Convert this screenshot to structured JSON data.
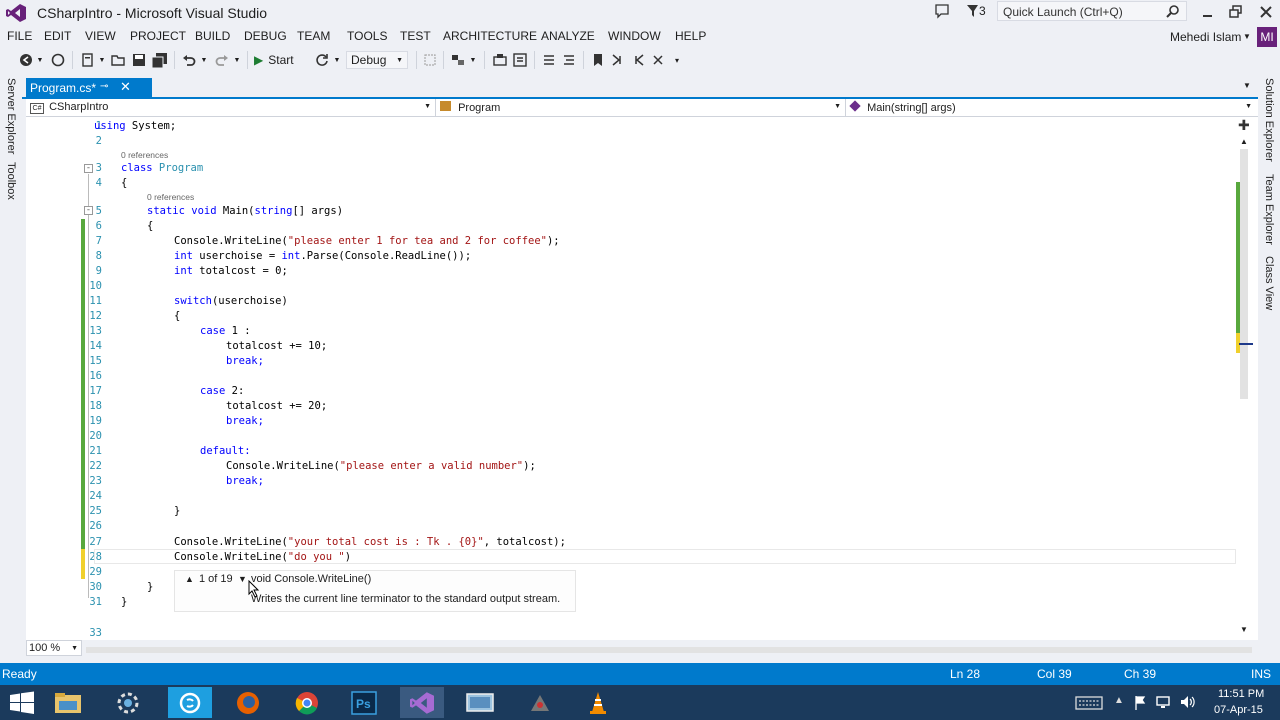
{
  "window": {
    "title": "CSharpIntro - Microsoft Visual Studio",
    "notification_count": "3",
    "quick_launch_placeholder": "Quick Launch (Ctrl+Q)",
    "user_name": "Mehedi Islam",
    "user_initials": "MI"
  },
  "menu": [
    "FILE",
    "EDIT",
    "VIEW",
    "PROJECT",
    "BUILD",
    "DEBUG",
    "TEAM",
    "TOOLS",
    "TEST",
    "ARCHITECTURE",
    "ANALYZE",
    "WINDOW",
    "HELP"
  ],
  "toolbar": {
    "start_label": "Start",
    "config_value": "Debug"
  },
  "left_panels": [
    "Server Explorer",
    "Toolbox"
  ],
  "right_panels": [
    "Solution Explorer",
    "Team Explorer",
    "Class View"
  ],
  "document_tab": {
    "label": "Program.cs*"
  },
  "nav": {
    "project": "CSharpIntro",
    "class": "Program",
    "member": "Main(string[] args)"
  },
  "code": {
    "references_label": "0 references",
    "line_numbers": [
      "1",
      "2",
      "3",
      "4",
      "5",
      "6",
      "7",
      "8",
      "9",
      "10",
      "11",
      "12",
      "13",
      "14",
      "15",
      "16",
      "17",
      "18",
      "19",
      "20",
      "21",
      "22",
      "23",
      "24",
      "25",
      "26",
      "27",
      "28",
      "29",
      "30",
      "31",
      "33"
    ],
    "lines": {
      "l1a": "using",
      "l1b": " System;",
      "l3a": "class",
      "l3b": " Program",
      "l4": "{",
      "l5a": "static",
      "l5b": " ",
      "l5c": "void",
      "l5d": " Main(",
      "l5e": "string",
      "l5f": "[] args)",
      "l6": "{",
      "l7a": "Console.WriteLine(",
      "l7b": "\"please enter 1 for tea and 2 for coffee\"",
      "l7c": ");",
      "l8a": "int",
      "l8b": " userchoise = ",
      "l8c": "int",
      "l8d": ".Parse(Console.ReadLine());",
      "l9a": "int",
      "l9b": " totalcost = 0;",
      "l11a": "switch",
      "l11b": "(userchoise)",
      "l12": "{",
      "l13a": "case",
      "l13b": " 1 :",
      "l14": "totalcost += 10;",
      "l15": "break;",
      "l17a": "case",
      "l17b": " 2:",
      "l18": "totalcost += 20;",
      "l19": "break;",
      "l21": "default:",
      "l22a": "Console.WriteLine(",
      "l22b": "\"please enter a valid number\"",
      "l22c": ");",
      "l23": "break;",
      "l25": "}",
      "l27a": "Console.WriteLine(",
      "l27b": "\"your total cost is : Tk . {0}\"",
      "l27c": ", totalcost);",
      "l28a": "Console.WriteLine(",
      "l28b": "\"do you \"",
      "l28c": ")",
      "l30": "}",
      "l31": "}"
    }
  },
  "tooltip": {
    "counter": "1 of 19",
    "signature": "void Console.WriteLine()",
    "description": "Writes the current line terminator to the standard output stream."
  },
  "zoom": "100 %",
  "status": {
    "state": "Ready",
    "line": "Ln 28",
    "col": "Col 39",
    "ch": "Ch 39",
    "mode": "INS"
  },
  "taskbar": {
    "time": "11:51 PM",
    "date": "07-Apr-15"
  },
  "colors": {
    "accent": "#007acc",
    "keyword": "#0000ff",
    "string": "#a31515",
    "type": "#2b91af",
    "change_marker": "#58a83d",
    "taskbar": "#1b3a5c"
  }
}
